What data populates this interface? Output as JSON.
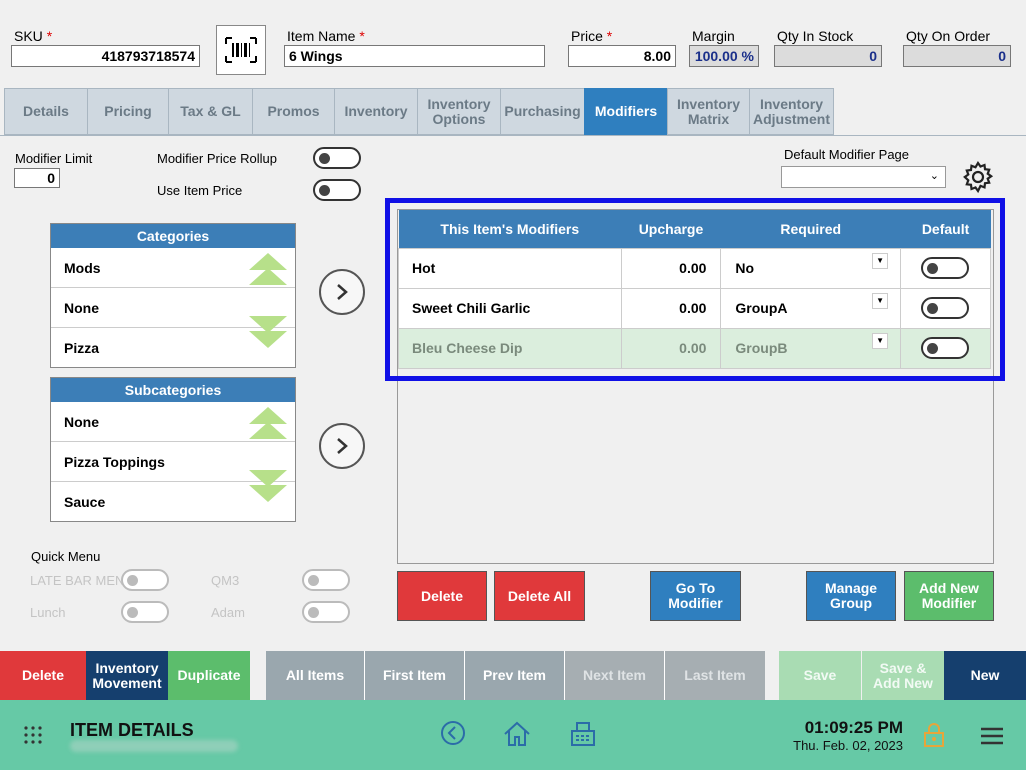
{
  "header": {
    "sku_label": "SKU",
    "sku_value": "418793718574",
    "item_name_label": "Item Name",
    "item_name_value": "6 Wings",
    "price_label": "Price",
    "price_value": "8.00",
    "margin_label": "Margin",
    "margin_value": "100.00 %",
    "qty_in_stock_label": "Qty In Stock",
    "qty_in_stock_value": "0",
    "qty_on_order_label": "Qty On Order",
    "qty_on_order_value": "0",
    "required_mark": "*"
  },
  "tabs": [
    {
      "label": "Details"
    },
    {
      "label": "Pricing"
    },
    {
      "label": "Tax & GL"
    },
    {
      "label": "Promos"
    },
    {
      "label": "Inventory"
    },
    {
      "label": "Inventory Options"
    },
    {
      "label": "Purchasing"
    },
    {
      "label": "Modifiers"
    },
    {
      "label": "Inventory Matrix"
    },
    {
      "label": "Inventory Adjustment"
    }
  ],
  "options": {
    "modifier_limit_label": "Modifier Limit",
    "modifier_limit_value": "0",
    "price_rollup_label": "Modifier Price Rollup",
    "use_item_price_label": "Use Item Price",
    "default_page_label": "Default Modifier Page",
    "default_page_value": ""
  },
  "categories": {
    "title": "Categories",
    "items": [
      "Mods",
      "None",
      "Pizza"
    ]
  },
  "subcategories": {
    "title": "Subcategories",
    "items": [
      "None",
      "Pizza Toppings",
      "Sauce"
    ]
  },
  "modifiers_table": {
    "headers": [
      "This Item's Modifiers",
      "Upcharge",
      "Required",
      "Default"
    ],
    "rows": [
      {
        "name": "Hot",
        "upcharge": "0.00",
        "required": "No"
      },
      {
        "name": "Sweet Chili Garlic",
        "upcharge": "0.00",
        "required": "GroupA"
      },
      {
        "name": "Bleu Cheese Dip",
        "upcharge": "0.00",
        "required": "GroupB"
      }
    ]
  },
  "quick_menu": {
    "title": "Quick Menu",
    "items": [
      "LATE BAR MENU",
      "QM3",
      "Lunch",
      "Adam"
    ]
  },
  "actions": {
    "delete": "Delete",
    "delete_all": "Delete All",
    "go_to_modifier": "Go To Modifier",
    "manage_group": "Manage Group",
    "add_new_modifier": "Add New Modifier"
  },
  "bottom_bar": {
    "delete": "Delete",
    "inventory_movement": "Inventory Movement",
    "duplicate": "Duplicate",
    "all_items": "All Items",
    "first_item": "First Item",
    "prev_item": "Prev Item",
    "next_item": "Next Item",
    "last_item": "Last Item",
    "save": "Save",
    "save_add_new": "Save & Add New",
    "new": "New"
  },
  "footer": {
    "title": "ITEM DETAILS",
    "time": "01:09:25 PM",
    "date": "Thu. Feb. 02, 2023"
  },
  "colors": {
    "accent_blue": "#2f7fbf",
    "table_header": "#3c7eb7",
    "footer_green": "#66c9a6",
    "delete_red": "#e0393b",
    "add_green": "#5cbd6c"
  }
}
